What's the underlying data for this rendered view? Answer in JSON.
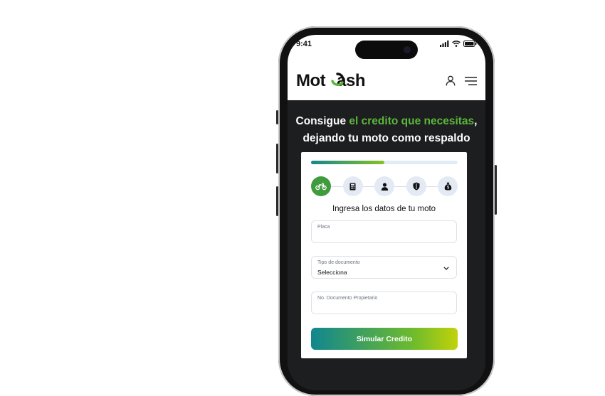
{
  "status_bar": {
    "time": "9:41",
    "icons": [
      "signal-icon",
      "wifi-icon",
      "battery-icon"
    ]
  },
  "header": {
    "logo": {
      "part1": "Mot",
      "part2": "ash"
    },
    "icons": [
      "user-icon",
      "menu-icon"
    ]
  },
  "hero": {
    "headline": {
      "line1_prefix": "Consigue ",
      "line1_highlight": "el credito que necesitas",
      "line1_suffix": ",",
      "line2": "dejando tu moto como respaldo"
    }
  },
  "form": {
    "progress": 0.5,
    "steps": [
      {
        "icon": "motorcycle-icon",
        "active": true
      },
      {
        "icon": "calculator-icon",
        "active": false
      },
      {
        "icon": "person-icon",
        "active": false
      },
      {
        "icon": "shield-icon",
        "active": false
      },
      {
        "icon": "money-bag-icon",
        "active": false
      }
    ],
    "title": "Ingresa los datos de tu moto",
    "fields": {
      "placa": {
        "label": "Placa",
        "value": ""
      },
      "tipo_documento": {
        "label": "Tipo de documento",
        "value": "Selecciona"
      },
      "documento": {
        "label": "No. Documento Propietario",
        "value": ""
      }
    },
    "submit_label": "Simular Credito"
  },
  "colors": {
    "brand_green": "#5bb73b",
    "hero_bg": "#1d1e20",
    "cta_gradient_start": "#11868f",
    "cta_gradient_end": "#c1d20a"
  }
}
